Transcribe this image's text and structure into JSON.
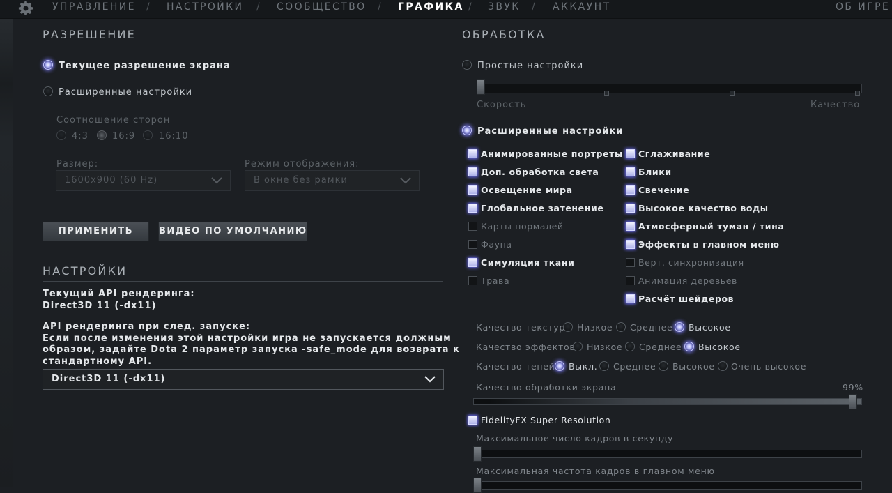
{
  "nav": {
    "items": [
      "УПРАВЛЕНИЕ",
      "НАСТРОЙКИ",
      "СООБЩЕСТВО",
      "ГРАФИКА",
      "ЗВУК",
      "АККАУНТ"
    ],
    "separator": "/",
    "active": "ГРАФИКА",
    "about": "ОБ ИГРЕ"
  },
  "resolution": {
    "title": "РАЗРЕШЕНИЕ",
    "current_label": "Текущее разрешение экрана",
    "advanced_label": "Расширенные настройки",
    "selected": "current",
    "aspect_label": "Соотношение сторон",
    "aspect_options": [
      "4:3",
      "16:9",
      "16:10"
    ],
    "aspect_selected": "16:9",
    "size_label": "Размер:",
    "size_value": "1600x900 (60 Hz)",
    "mode_label": "Режим отображения:",
    "mode_value": "В окне без рамки",
    "apply_button": "ПРИМЕНИТЬ",
    "default_button": "ВИДЕО ПО УМОЛЧАНИЮ"
  },
  "settings": {
    "title": "НАСТРОЙКИ",
    "current_api_label": "Текущий API рендеринга:",
    "current_api_value": "Direct3D 11 (-dx11)",
    "next_api_label": "API рендеринга при след. запуске:",
    "warning_line1": "Если после изменения этой настройки игра не запускается должным",
    "warning_line2": "образом, задайте Dota 2 параметр запуска -safe_mode для возврата к",
    "warning_line3": "стандартному API.",
    "api_dropdown_value": "Direct3D 11 (-dx11)"
  },
  "processing": {
    "title": "ОБРАБОТКА",
    "simple_label": "Простые настройки",
    "speed_label": "Скорость",
    "quality_label": "Качество",
    "simple_slider_level": 0,
    "advanced_label": "Расширенные настройки",
    "selected": "advanced",
    "left_checkboxes": [
      {
        "label": "Анимированные портреты",
        "checked": true
      },
      {
        "label": "Доп. обработка света",
        "checked": true
      },
      {
        "label": "Освещение мира",
        "checked": true
      },
      {
        "label": "Глобальное затенение",
        "checked": true
      },
      {
        "label": "Карты нормалей",
        "checked": false
      },
      {
        "label": "Фауна",
        "checked": false
      },
      {
        "label": "Симуляция ткани",
        "checked": true
      },
      {
        "label": "Трава",
        "checked": false
      }
    ],
    "right_checkboxes": [
      {
        "label": "Сглаживание",
        "checked": true
      },
      {
        "label": "Блики",
        "checked": true
      },
      {
        "label": "Свечение",
        "checked": true
      },
      {
        "label": "Высокое качество воды",
        "checked": true
      },
      {
        "label": "Атмосферный туман / тина",
        "checked": true
      },
      {
        "label": "Эффекты в главном меню",
        "checked": true
      },
      {
        "label": "Верт. синхронизация",
        "checked": false
      },
      {
        "label": "Анимация деревьев",
        "checked": false
      },
      {
        "label": "Расчёт шейдеров",
        "checked": true
      }
    ],
    "texture_quality": {
      "label": "Качество текстур",
      "options": [
        "Низкое",
        "Среднее",
        "Высокое"
      ],
      "selected": "Высокое"
    },
    "effects_quality": {
      "label": "Качество эффектов",
      "options": [
        "Низкое",
        "Среднее",
        "Высокое"
      ],
      "selected": "Высокое"
    },
    "shadow_quality": {
      "label": "Качество теней",
      "options": [
        "Выкл.",
        "Среднее",
        "Высокое",
        "Очень высокое"
      ],
      "selected": "Выкл."
    },
    "screen_quality_label": "Качество обработки экрана",
    "screen_quality_value": "99%",
    "screen_quality_level": 0.99,
    "fsr_label": "FidelityFX Super Resolution",
    "fsr_checked": true,
    "max_fps_label": "Максимальное число кадров в секунду",
    "max_fps_level": 0,
    "max_menu_fps_label": "Максимальная частота кадров в главном меню",
    "max_menu_fps_level": 0
  }
}
